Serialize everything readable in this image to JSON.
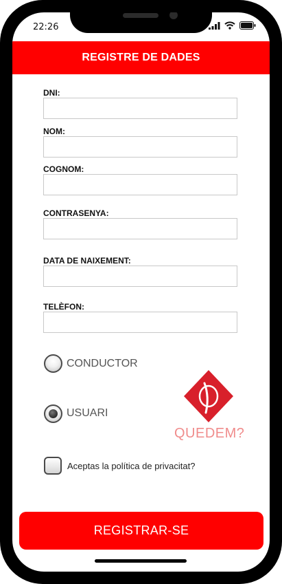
{
  "status_bar": {
    "time": "22:26"
  },
  "header": {
    "title": "REGISTRE DE DADES"
  },
  "form": {
    "fields": [
      {
        "label": "DNI:",
        "value": ""
      },
      {
        "label": "NOM:",
        "value": ""
      },
      {
        "label": "COGNOM:",
        "value": ""
      },
      {
        "label": "CONTRASENYA:",
        "value": ""
      },
      {
        "label": "DATA DE NAIXEMENT:",
        "value": ""
      },
      {
        "label": "TELÈFON:",
        "value": ""
      }
    ]
  },
  "role": {
    "options": [
      {
        "label": "CONDUCTOR",
        "selected": false
      },
      {
        "label": "USUARI",
        "selected": true
      }
    ]
  },
  "logo": {
    "text": "QUEDEM?"
  },
  "privacy": {
    "label": "Aceptas la política de privacitat?",
    "checked": false
  },
  "submit": {
    "label": "REGISTRAR-SE"
  },
  "colors": {
    "accent": "#ff0000",
    "logo_red": "#d8202b",
    "logo_text": "#f08c8c"
  }
}
